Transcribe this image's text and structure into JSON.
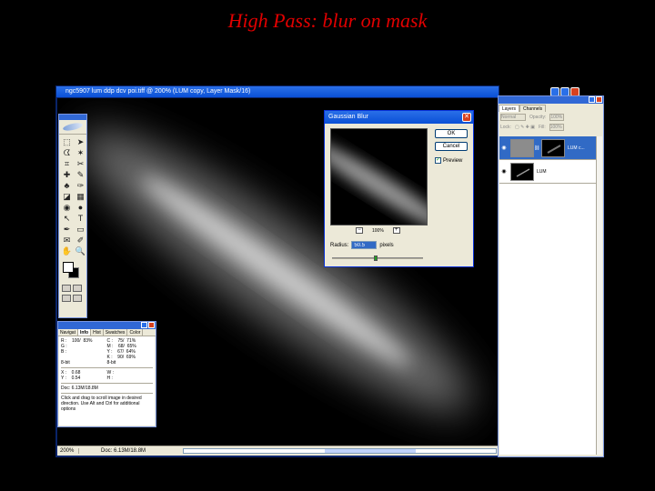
{
  "slide_title": "High Pass: blur on mask",
  "document": {
    "title": "ngc5907 lum ddp dcv poi.tiff @ 200% (LUM copy, Layer Mask/16)",
    "status_zoom": "200%",
    "status_doc": "Doc: 6.13M/18.8M"
  },
  "tools": {
    "icons": [
      "marquee-tool-icon",
      "move-tool-icon",
      "lasso-tool-icon",
      "magic-wand-tool-icon",
      "crop-tool-icon",
      "slice-tool-icon",
      "heal-tool-icon",
      "brush-tool-icon",
      "stamp-tool-icon",
      "history-brush-icon",
      "eraser-tool-icon",
      "gradient-tool-icon",
      "blur-tool-icon",
      "dodge-tool-icon",
      "path-select-tool-icon",
      "type-tool-icon",
      "pen-tool-icon",
      "shape-tool-icon",
      "notes-tool-icon",
      "eyedropper-tool-icon",
      "hand-tool-icon",
      "zoom-tool-icon"
    ],
    "glyphs": [
      "⬚",
      "➤",
      "ᗧ",
      "✶",
      "⌗",
      "✂",
      "✚",
      "✎",
      "♣",
      "✑",
      "◪",
      "▦",
      "◉",
      "●",
      "↖",
      "T",
      "✒",
      "▭",
      "✉",
      "✐",
      "✋",
      "🔍"
    ]
  },
  "info": {
    "tabs": [
      "Navigat",
      "Info",
      "Hist",
      "Swatches",
      "Color"
    ],
    "active_tab": "Info",
    "rgb": "R :    100/  83%\nG :\nB :",
    "cmyk": "C :    75/  71%\nM :    68/  65%\nY :    67/  64%\nK :    90/  69%",
    "bits_left": "8-bit",
    "bits_right": "8-bit",
    "xy": "X :    0.68\nY :    0.54",
    "wh": "W :\nH :",
    "doc": "Doc: 6.13M/18.8M",
    "help": "Click and drag to scroll image in desired direction.  Use Alt and Ctrl for additional options"
  },
  "dialog": {
    "title": "Gaussian Blur",
    "ok_label": "OK",
    "cancel_label": "Cancel",
    "preview_label": "Preview",
    "preview_checked": true,
    "zoom_percent": "100%",
    "radius_label": "Radius:",
    "radius_value": "50.5",
    "radius_unit": "pixels"
  },
  "layers": {
    "tabs": [
      "Layers",
      "Channels"
    ],
    "active_tab": "Layers",
    "blend_mode": "Normal",
    "opacity_label": "Opacity:",
    "opacity_value": "100%",
    "lock_label": "Lock:",
    "fill_label": "Fill:",
    "fill_value": "100%",
    "items": [
      {
        "name": "LUM c...",
        "selected": true
      },
      {
        "name": "LUM",
        "selected": false
      }
    ]
  }
}
